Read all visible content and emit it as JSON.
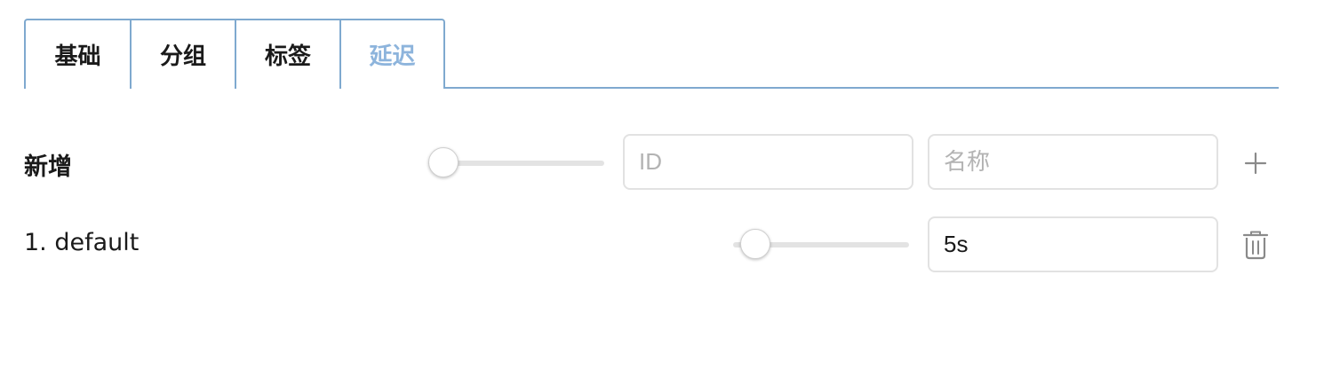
{
  "tabs": [
    {
      "label": "基础",
      "active": false
    },
    {
      "label": "分组",
      "active": false
    },
    {
      "label": "标签",
      "active": false
    },
    {
      "label": "延迟",
      "active": true
    }
  ],
  "add_row": {
    "label": "新增",
    "slider_level": 0,
    "id_placeholder": "ID",
    "name_placeholder": "名称",
    "add_icon": "plus-icon"
  },
  "items": [
    {
      "label": "1. default",
      "slider_level": 0.12,
      "value": "5s",
      "delete_icon": "trash-icon"
    }
  ],
  "colors": {
    "accent": "#7fa9cf",
    "active_tab_text": "#8db4dc",
    "placeholder": "#b3b3b3",
    "icon": "#8a8a8a"
  }
}
